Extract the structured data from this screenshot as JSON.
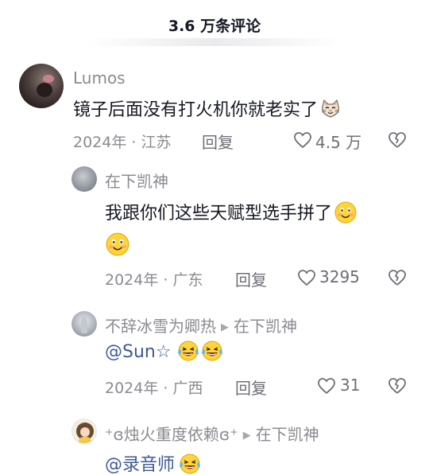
{
  "header": {
    "title": "3.6 万条评论"
  },
  "comments": [
    {
      "user": "Lumos",
      "text": "镜子后面没有打火机你就老实了",
      "date": "2024年 · 江苏",
      "reply_label": "回复",
      "likes": "4.5 万",
      "emoji": "cat-face-emoji"
    },
    {
      "user": "在下凯神",
      "text": "我跟你们这些天赋型选手拼了",
      "date": "2024年 · 广东",
      "reply_label": "回复",
      "likes": "3295",
      "emoji": "smiling-face-emoji"
    },
    {
      "user": "不辞冰雪为卿热",
      "reply_to": "在下凯神",
      "mention": "@Sun☆",
      "date": "2024年 · 广西",
      "reply_label": "回复",
      "likes": "31",
      "emoji": "laughing-tears-emoji"
    },
    {
      "user": "⁺ɞ烛火重度依赖ɞ⁺",
      "reply_to": "在下凯神",
      "mention": "@录音师",
      "emoji": "laughing-tears-emoji"
    }
  ],
  "colors": {
    "name": "#8a8b91",
    "text": "#161823",
    "mention": "#3e5a9a",
    "meta": "#8a8b91"
  }
}
